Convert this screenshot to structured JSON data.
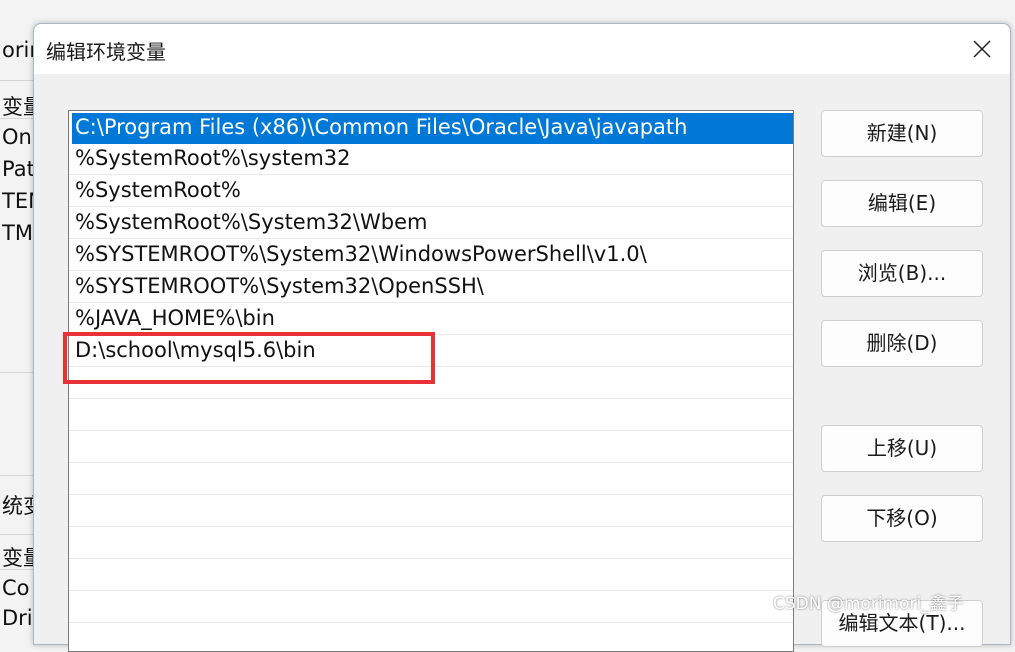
{
  "background_window": {
    "title_fragment": "orir",
    "user_vars_header_fragment": "变量",
    "user_vars": [
      "On",
      "Pat",
      "TEN",
      "TM"
    ],
    "system_section_fragment": "统变",
    "system_header_fragment": "变量",
    "system_vars": [
      "Co",
      "Dri"
    ]
  },
  "dialog": {
    "title": "编辑环境变量",
    "close_icon": "close-icon"
  },
  "path_list": {
    "items": [
      {
        "value": "C:\\Program Files (x86)\\Common Files\\Oracle\\Java\\javapath",
        "selected": true
      },
      {
        "value": "%SystemRoot%\\system32",
        "selected": false
      },
      {
        "value": "%SystemRoot%",
        "selected": false
      },
      {
        "value": "%SystemRoot%\\System32\\Wbem",
        "selected": false
      },
      {
        "value": "%SYSTEMROOT%\\System32\\WindowsPowerShell\\v1.0\\",
        "selected": false
      },
      {
        "value": "%SYSTEMROOT%\\System32\\OpenSSH\\",
        "selected": false
      },
      {
        "value": "%JAVA_HOME%\\bin",
        "selected": false
      },
      {
        "value": "D:\\school\\mysql5.6\\bin",
        "selected": false,
        "annotated": true
      }
    ]
  },
  "buttons": {
    "new": "新建(N)",
    "edit": "编辑(E)",
    "browse": "浏览(B)...",
    "delete": "删除(D)",
    "move_up": "上移(U)",
    "move_down": "下移(O)",
    "edit_text": "编辑文本(T)..."
  },
  "watermark": "CSDN @morimori_鑫子",
  "colors": {
    "selection": "#0078d7",
    "annotation_box": "#e8323a"
  }
}
